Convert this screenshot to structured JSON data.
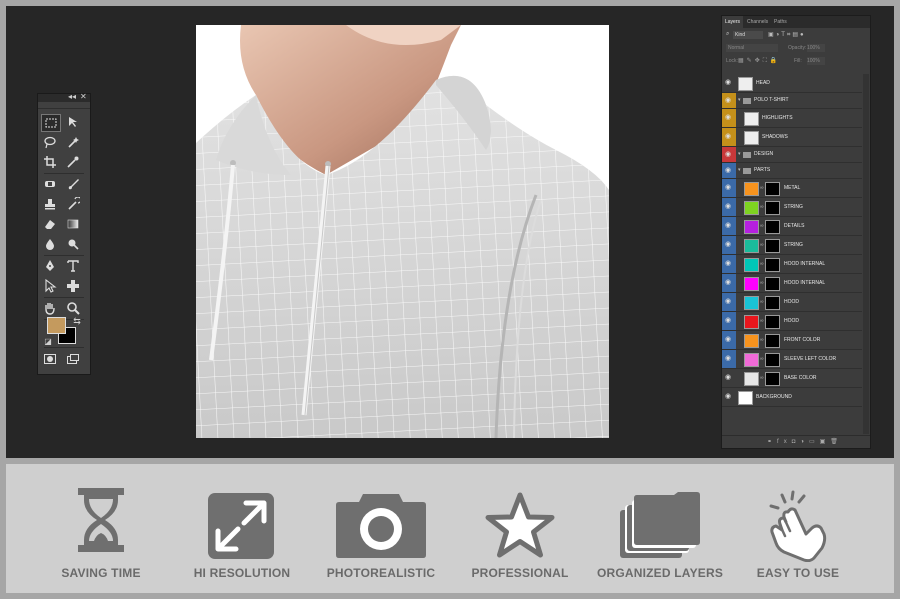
{
  "toolbox": {
    "collapse_label": "◂◂",
    "close_label": "✕",
    "foreground_color": "#c49a5e",
    "background_color": "#000000"
  },
  "layers_panel": {
    "tabs": [
      {
        "label": "Layers",
        "active": true
      },
      {
        "label": "Channels",
        "active": false
      },
      {
        "label": "Paths",
        "active": false
      }
    ],
    "filter_label": "Kind",
    "blend_mode": "Normal",
    "opacity_label": "Opacity:",
    "opacity_value": "100%",
    "lock_label": "Lock:",
    "fill_label": "Fill:",
    "fill_value": "100%",
    "layers": [
      {
        "name": "HEAD",
        "type": "image",
        "eye_color": "#3c3c3c"
      },
      {
        "name": "POLO T-SHIRT",
        "type": "group",
        "eye_color": "#c4901a"
      },
      {
        "name": "HIGHLIGHTS",
        "type": "image",
        "eye_color": "#c4901a"
      },
      {
        "name": "SHADOWS",
        "type": "image",
        "eye_color": "#c4901a"
      },
      {
        "name": "DESIGN",
        "type": "group",
        "eye_color": "#c8383a"
      },
      {
        "name": "PARTS",
        "type": "group",
        "eye_color": "#3b6aa8"
      },
      {
        "name": "METAL",
        "type": "color",
        "swatch": "#f7931e",
        "eye_color": "#3b6aa8"
      },
      {
        "name": "STRING",
        "type": "color",
        "swatch": "#7ed321",
        "eye_color": "#3b6aa8"
      },
      {
        "name": "DETAILS",
        "type": "color",
        "swatch": "#b620e0",
        "eye_color": "#3b6aa8"
      },
      {
        "name": "STRING",
        "type": "color",
        "swatch": "#1abc9c",
        "eye_color": "#3b6aa8"
      },
      {
        "name": "HOOD INTERNAL",
        "type": "color",
        "swatch": "#00c7b7",
        "eye_color": "#3b6aa8"
      },
      {
        "name": "HOOD INTERNAL",
        "type": "color",
        "swatch": "#ff00ff",
        "eye_color": "#3b6aa8"
      },
      {
        "name": "HOOD",
        "type": "color",
        "swatch": "#19c3d6",
        "eye_color": "#3b6aa8"
      },
      {
        "name": "HOOD",
        "type": "color",
        "swatch": "#e8161d",
        "eye_color": "#3b6aa8"
      },
      {
        "name": "FRONT COLOR",
        "type": "color",
        "swatch": "#f7931e",
        "eye_color": "#3b6aa8"
      },
      {
        "name": "SLEEVE LEFT COLOR",
        "type": "color",
        "swatch": "#f06ad7",
        "eye_color": "#3b6aa8"
      },
      {
        "name": "BASE COLOR",
        "type": "color",
        "swatch": "#e6e6e6",
        "eye_color": "#3c3c3c"
      },
      {
        "name": "BACKGROUND",
        "type": "plain",
        "swatch": "#ffffff",
        "eye_color": "#3c3c3c"
      }
    ]
  },
  "features": [
    {
      "label": "SAVING TIME",
      "icon": "hourglass-icon"
    },
    {
      "label": "HI RESOLUTION",
      "icon": "expand-arrows-icon"
    },
    {
      "label": "PHOTOREALISTIC",
      "icon": "camera-icon"
    },
    {
      "label": "PROFESSIONAL",
      "icon": "star-icon"
    },
    {
      "label": "ORGANIZED LAYERS",
      "icon": "folders-icon"
    },
    {
      "label": "EASY TO USE",
      "icon": "tap-hand-icon"
    }
  ],
  "colors": {
    "icon_gray": "#6f6f6f",
    "workspace": "#262626",
    "frame": "#a6a6a6",
    "banner": "#cfcfcf"
  }
}
